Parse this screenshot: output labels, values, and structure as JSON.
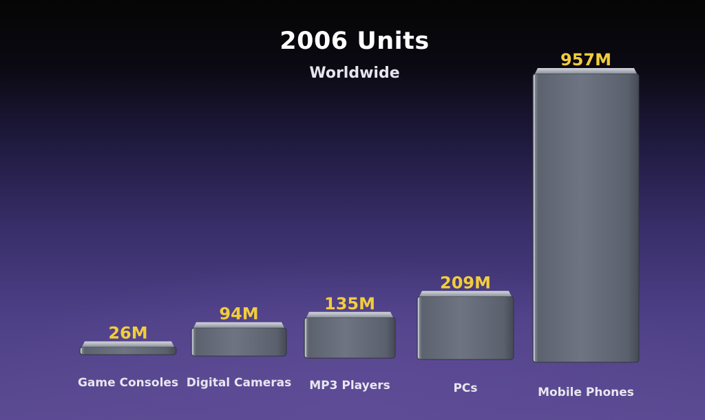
{
  "slide": {
    "title": "2006 Units",
    "subtitle": "Worldwide"
  },
  "chart_data": {
    "type": "bar",
    "title": "2006 Units",
    "subtitle": "Worldwide",
    "categories": [
      "Game Consoles",
      "Digital Cameras",
      "MP3 Players",
      "PCs",
      "Mobile Phones"
    ],
    "values": [
      26,
      94,
      135,
      209,
      957
    ],
    "value_labels": [
      "26M",
      "94M",
      "135M",
      "209M",
      "957M"
    ],
    "unit": "M",
    "ylim": [
      0,
      957
    ],
    "grid": false,
    "legend": "none"
  },
  "colors": {
    "value_label": "#f2cd3c",
    "category_label": "#e8e6f0",
    "bar_front": "#6c7280",
    "bar_top": "#b9bdc6"
  }
}
